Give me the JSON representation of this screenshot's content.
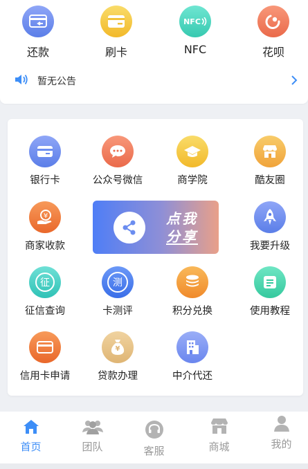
{
  "quick_actions": [
    {
      "label": "还款",
      "icon": "repay-card-icon",
      "color": "#6b8df0"
    },
    {
      "label": "刷卡",
      "icon": "swipe-card-icon",
      "color": "#f5c93f"
    },
    {
      "label": "NFC",
      "icon": "nfc-icon",
      "icon_text": "NFC",
      "color": "#4fd8c2"
    },
    {
      "label": "花呗",
      "icon": "huabei-icon",
      "color": "#f07b5a"
    }
  ],
  "notice": {
    "text": "暂无公告",
    "icon": "speaker-icon"
  },
  "services": [
    {
      "label": "银行卡",
      "icon": "bank-card-icon",
      "color": "#6b8df0"
    },
    {
      "label": "公众号微信",
      "icon": "chat-bubble-icon",
      "color": "#f07b5a"
    },
    {
      "label": "商学院",
      "icon": "graduation-cap-icon",
      "color": "#f5c93f"
    },
    {
      "label": "酷友圈",
      "icon": "store-icon",
      "color": "#f5b74a"
    },
    {
      "label": "商家收款",
      "icon": "yuan-hand-icon",
      "color": "#f07a3a"
    },
    {
      "label": "我要升级",
      "icon": "rocket-icon",
      "color": "#6b8df0"
    },
    {
      "label": "征信查询",
      "icon": "credit-shield-icon",
      "icon_text": "征",
      "color": "#3fcdc3"
    },
    {
      "label": "卡测评",
      "icon": "card-test-icon",
      "icon_text": "测",
      "color": "#4a7ef2"
    },
    {
      "label": "积分兑换",
      "icon": "coins-icon",
      "color": "#f5a03a"
    },
    {
      "label": "使用教程",
      "icon": "document-icon",
      "color": "#4ed8b4"
    },
    {
      "label": "信用卡申请",
      "icon": "credit-card-icon",
      "color": "#f07a3a"
    },
    {
      "label": "贷款办理",
      "icon": "money-bag-icon",
      "icon_text": "¥",
      "color": "#e9c58a"
    },
    {
      "label": "中介代还",
      "icon": "building-icon",
      "color": "#7b95f2"
    }
  ],
  "share_banner": {
    "line1": "点我",
    "line2": "分享",
    "icon": "share-icon"
  },
  "tabbar": [
    {
      "label": "首页",
      "icon": "home-icon",
      "active": true
    },
    {
      "label": "团队",
      "icon": "team-icon",
      "active": false
    },
    {
      "label": "客服",
      "icon": "headset-icon",
      "active": false
    },
    {
      "label": "商城",
      "icon": "shop-icon",
      "active": false
    },
    {
      "label": "我的",
      "icon": "profile-icon",
      "active": false
    }
  ],
  "colors": {
    "accent": "#3d8ef7",
    "inactive": "#999999"
  }
}
